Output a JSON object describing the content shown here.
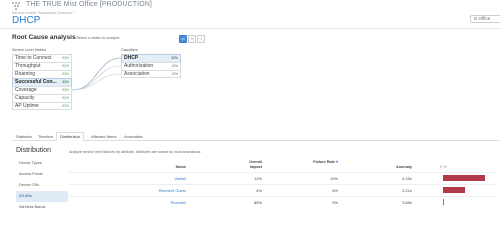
{
  "header": {
    "site_title": "THE TRUE Mist Office [PRODUCTION]",
    "breadcrumb": "Service Levels / Successful Connects /",
    "page_title": "DHCP",
    "office_button": "Office"
  },
  "root_cause": {
    "title": "Root Cause analysis",
    "subtitle": "Select a metric to analyze",
    "tools": [
      "+",
      "↓"
    ],
    "metrics_label": "Service Level Metrics",
    "classifiers_label": "Classifiers",
    "metrics": [
      {
        "name": "Time to Connect",
        "pct": "93%"
      },
      {
        "name": "Throughput",
        "pct": "92%"
      },
      {
        "name": "Roaming",
        "pct": "93%"
      },
      {
        "name": "Successful Con...",
        "pct": "92%"
      },
      {
        "name": "Coverage",
        "pct": "93%"
      },
      {
        "name": "Capacity",
        "pct": "92%"
      },
      {
        "name": "AP Uptime",
        "pct": "93%"
      }
    ],
    "classifiers": [
      {
        "name": "DHCP",
        "pct": "32%"
      },
      {
        "name": "Authorization",
        "pct": "13%"
      },
      {
        "name": "Association",
        "pct": "13%"
      }
    ]
  },
  "tabs": [
    "Statistics",
    "Timeline",
    "Distribution",
    "Affected Items",
    "Anomalies"
  ],
  "distribution": {
    "title": "Distribution",
    "description": "Analyze service level failures by attribute. Attributes are sorted by most anomalous.",
    "side_items": [
      "Device Types",
      "Access Points",
      "Device OSs",
      "WLANs",
      "Wireless Bands"
    ],
    "columns": {
      "name": "Name",
      "overall_impact": "Overall Impact",
      "failure_rate": "Failure Rate",
      "anomaly": "Anomaly",
      "axis_0": "0",
      "axis_pct": "%"
    },
    "rows": [
      {
        "name": "Valhall",
        "impact": "12%",
        "failure": "10%",
        "anomaly": "4.20x",
        "anomaly_value": 4.2
      },
      {
        "name": "Riverdell Guest",
        "impact": "4%",
        "failure": "5%",
        "anomaly": "2.21x",
        "anomaly_value": 2.21
      },
      {
        "name": "Riverdell",
        "impact": "85%",
        "failure": "3%",
        "anomaly": "3.89x",
        "anomaly_value": 0.1
      }
    ]
  },
  "colors": {
    "accent": "#2f7fd1",
    "bar_red": "#b03a48",
    "bar_green": "#5a9b3a",
    "selected": "#e3eef9"
  }
}
